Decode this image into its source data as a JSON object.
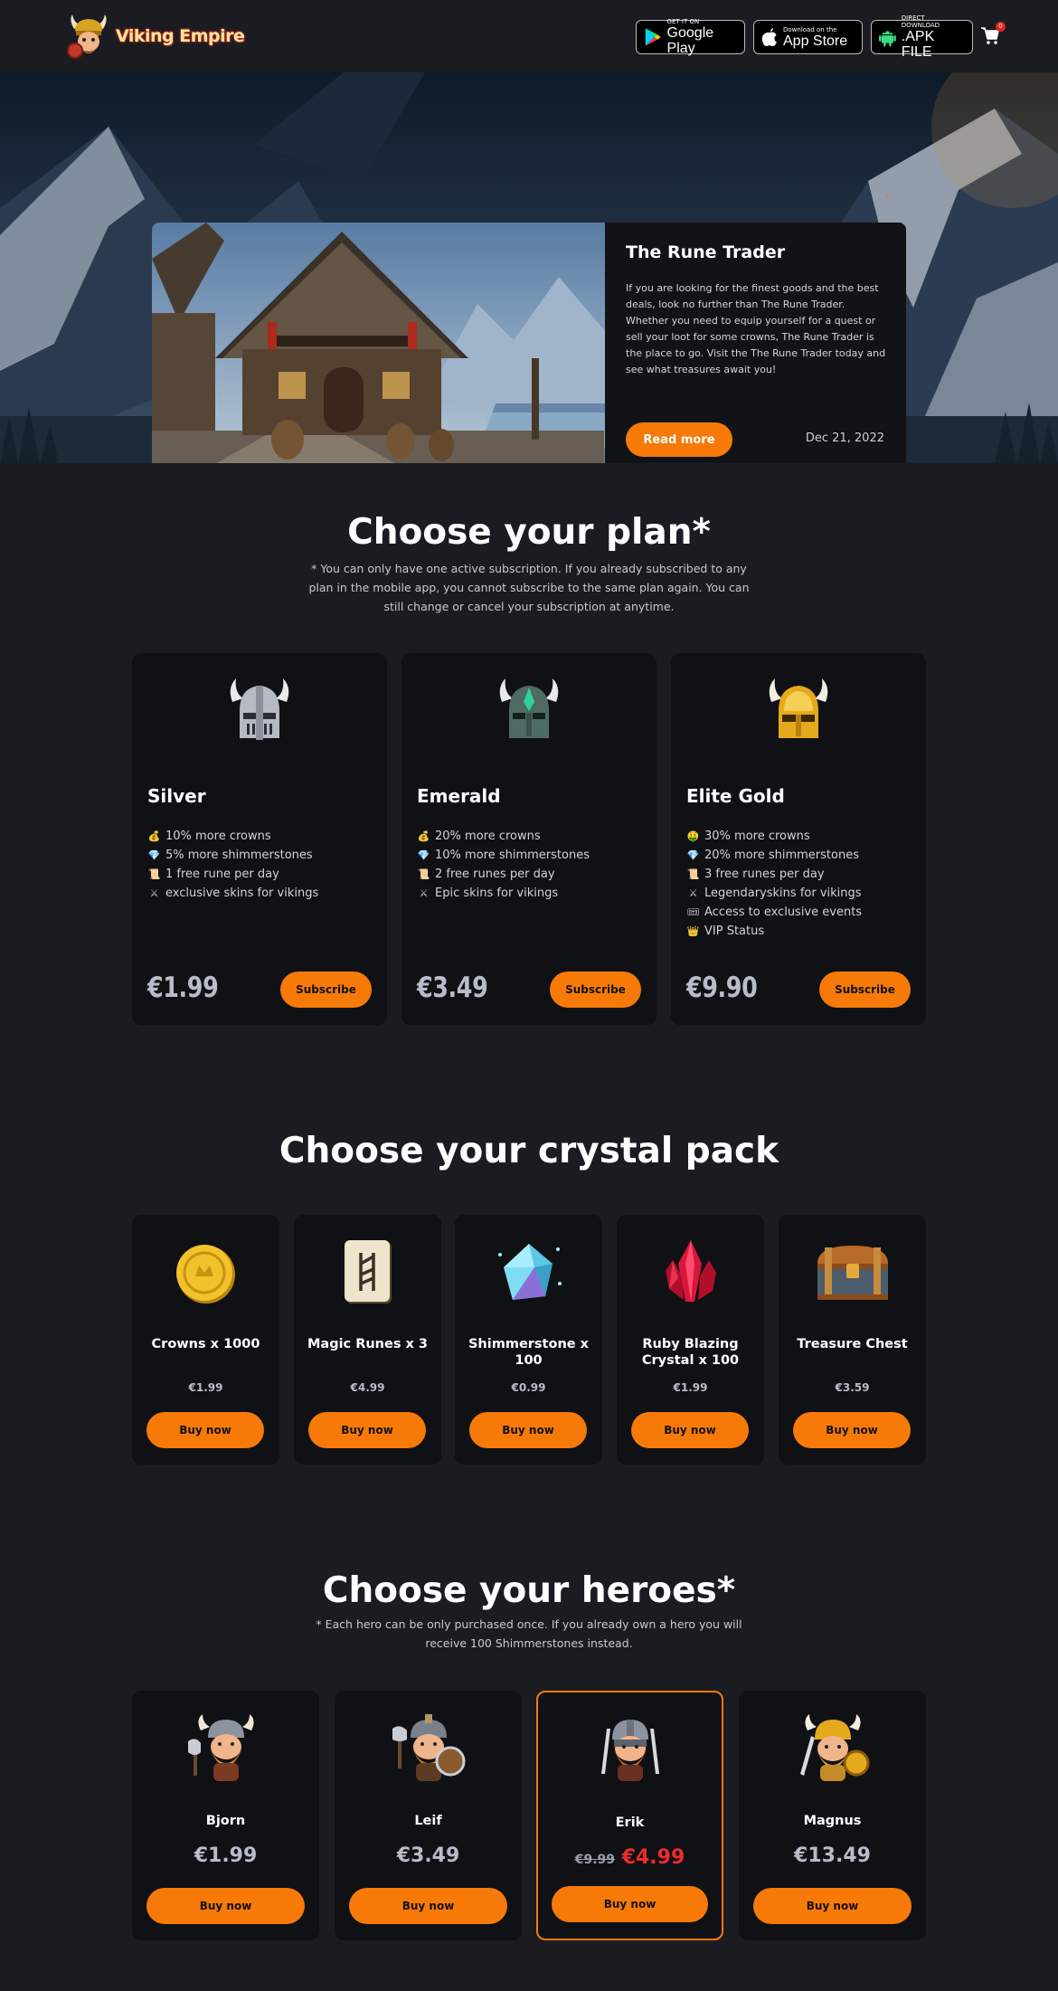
{
  "header": {
    "logo_text": "Viking Empire",
    "stores": [
      {
        "small": "GET IT ON",
        "big": "Google Play",
        "icon": "google-play-icon"
      },
      {
        "small": "Download on the",
        "big": "App Store",
        "icon": "apple-icon"
      },
      {
        "small": "DIRECT DOWNLOAD",
        "big": ".APK FILE",
        "icon": "android-icon"
      }
    ],
    "cart_count": "0"
  },
  "hero": {
    "title": "The Rune Trader",
    "text": "If you are looking for the finest goods and the best deals, look no further than The Rune Trader. Whether you need to equip yourself for a quest or sell your loot for some crowns, The Rune Trader is the place to go. Visit the The Rune Trader today and see what treasures await you!",
    "button": "Read more",
    "date": "Dec 21, 2022",
    "arrow": "›"
  },
  "plans": {
    "title": "Choose your plan*",
    "note": "* You can only have one active subscription. If you already subscribed to any plan in the mobile app, you cannot subscribe to the same plan again. You can still change or cancel your subscription at anytime.",
    "items": [
      {
        "name": "Silver",
        "price": "€1.99",
        "button": "Subscribe",
        "color": "#b5bac3",
        "features": [
          {
            "icon": "💰",
            "text": "10% more crowns"
          },
          {
            "icon": "💎",
            "text": "5% more shimmerstones"
          },
          {
            "icon": "📜",
            "text": "1 free rune per day"
          },
          {
            "icon": "⚔",
            "text": "exclusive skins for vikings"
          }
        ]
      },
      {
        "name": "Emerald",
        "price": "€3.49",
        "button": "Subscribe",
        "color": "#4d6b62",
        "features": [
          {
            "icon": "💰",
            "text": "20% more crowns"
          },
          {
            "icon": "💎",
            "text": "10% more shimmerstones"
          },
          {
            "icon": "📜",
            "text": "2 free runes per day"
          },
          {
            "icon": "⚔",
            "text": "Epic skins for vikings"
          }
        ]
      },
      {
        "name": "Elite Gold",
        "price": "€9.90",
        "button": "Subscribe",
        "color": "#e5a91c",
        "features": [
          {
            "icon": "🤑",
            "text": "30% more crowns"
          },
          {
            "icon": "💎",
            "text": "20% more shimmerstones"
          },
          {
            "icon": "📜",
            "text": "3 free runes per day"
          },
          {
            "icon": "⚔",
            "text": "Legendaryskins for vikings"
          },
          {
            "icon": "🎟",
            "text": "Access to exclusive events"
          },
          {
            "icon": "👑",
            "text": "VIP Status"
          }
        ]
      }
    ]
  },
  "packs": {
    "title": "Choose your crystal pack",
    "items": [
      {
        "name": "Crowns x 1000",
        "price": "€1.99",
        "button": "Buy now",
        "icon": "gold-coin-icon"
      },
      {
        "name": "Magic Runes x 3",
        "price": "€4.99",
        "button": "Buy now",
        "icon": "rune-stone-icon"
      },
      {
        "name": "Shimmerstone x 100",
        "price": "€0.99",
        "button": "Buy now",
        "icon": "blue-crystal-icon"
      },
      {
        "name": "Ruby Blazing Crystal x 100",
        "price": "€1.99",
        "button": "Buy now",
        "icon": "ruby-crystal-icon"
      },
      {
        "name": "Treasure Chest",
        "price": "€3.59",
        "button": "Buy now",
        "icon": "treasure-chest-icon"
      }
    ]
  },
  "heroes": {
    "title": "Choose your heroes*",
    "note": "* Each hero can be only purchased once. If you already own a hero you will receive 100 Shimmerstones instead.",
    "items": [
      {
        "name": "Bjorn",
        "price": "€1.99",
        "button": "Buy now",
        "beard": "#d1893a"
      },
      {
        "name": "Leif",
        "price": "€3.49",
        "button": "Buy now",
        "beard": "#c77a2c"
      },
      {
        "name": "Erik",
        "old_price": "€9.99",
        "price": "€4.99",
        "button": "Buy now",
        "beard": "#c46d25",
        "highlight": true
      },
      {
        "name": "Magnus",
        "price": "€13.49",
        "button": "Buy now",
        "beard": "#d59a3a"
      }
    ]
  },
  "colors": {
    "accent": "#f77a08",
    "card": "#101115",
    "bg": "#1b1c21",
    "sale": "#ef2b2b"
  }
}
